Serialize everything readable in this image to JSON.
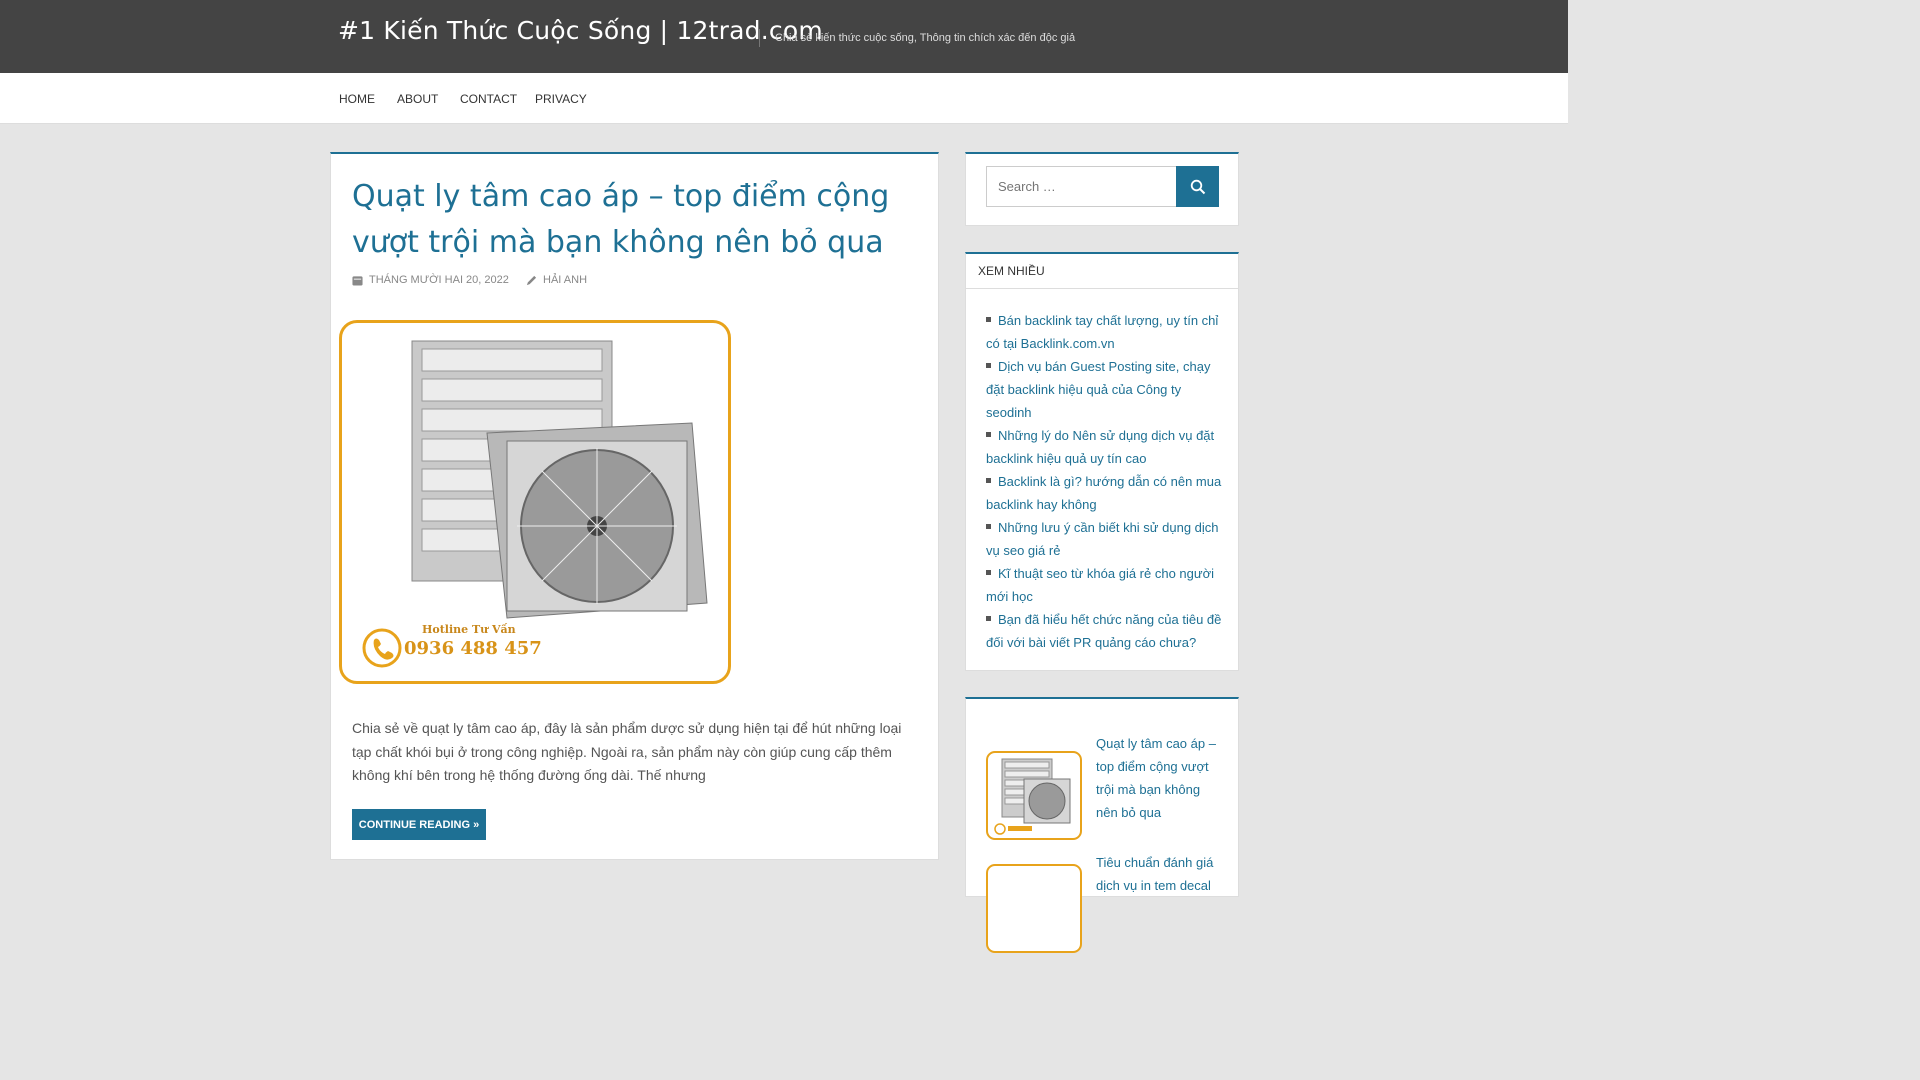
{
  "site": {
    "title": "#1 Kiến Thức Cuộc Sống | 12trad.com",
    "tagline": "Chia sẻ kiến thức cuộc sống, Thông tin chích xác đến độc giả"
  },
  "nav": [
    "HOME",
    "ABOUT",
    "CONTACT",
    "PRIVACY"
  ],
  "post": {
    "title": "Quạt ly tâm cao áp – top điểm cộng vượt trội mà bạn không nên bỏ qua",
    "date": "THÁNG MƯỜI HAI 20, 2022",
    "author": "HẢI ANH",
    "image_caption_line1": "Hotline Tư Vấn",
    "image_caption_line2": "0936 488 457",
    "excerpt": "Chia sẻ về quạt ly tâm cao áp, đây là sản phẩm dược sử dụng hiện tại để hút những loại tạp chất khói bụi ở trong công nghiệp. Ngoài ra, sản phẩm này còn giúp cung cấp thêm không khí bên trong hệ thống đường ống dài. Thế nhưng",
    "continue_label": "CONTINUE READING »"
  },
  "sidebar": {
    "search_placeholder": "Search …",
    "popular_title": "XEM NHIỀU",
    "popular": [
      "Bán backlink tay chất lượng, uy tín chỉ có tại Backlink.com.vn",
      "Dịch vụ bán Guest Posting site, chạy đặt backlink hiệu quả của Công ty seodinh",
      "Những lý do Nên sử dụng dịch vụ đặt backlink hiệu quả uy tín cao",
      "Backlink là gì? hướng dẫn có nên mua backlink hay không",
      "Những lưu ý cần biết khi sử dụng dịch vụ seo giá rẻ",
      "Kĩ thuật seo từ khóa giá rẻ cho người mới học",
      "Bạn đã hiểu hết chức năng của tiêu đề đối với bài viết PR quảng cáo chưa?"
    ],
    "recent": [
      "Quạt ly tâm cao áp – top điểm cộng vượt trội mà bạn không nên bỏ qua",
      "Tiêu chuẩn đánh giá dịch vụ in tem decal"
    ]
  },
  "colors": {
    "accent": "#1e7094",
    "header_bg": "#444444",
    "image_frame": "#e8a31b"
  }
}
